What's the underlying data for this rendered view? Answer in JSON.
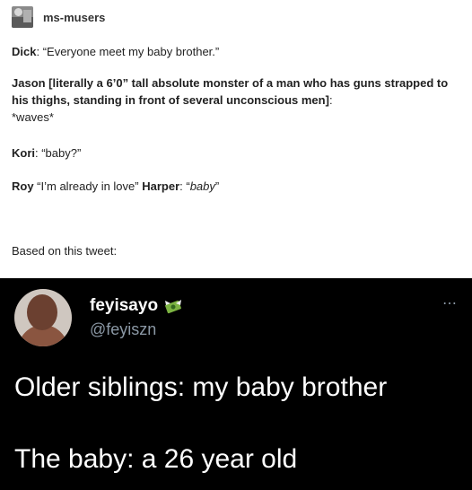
{
  "post": {
    "username": "ms-musers",
    "lines": {
      "dick_name": "Dick",
      "dick_text": ": “Everyone meet my baby brother.”",
      "jason_name": "Jason [literally a 6’0” tall absolute monster of a man who has guns strapped to his thighs, standing in front of several unconscious men]",
      "jason_colon": ":",
      "jason_text": "*waves*",
      "kori_name": "Kori",
      "kori_text": ": “baby?”",
      "roy_name": "Roy",
      "roy_text": " “I’m already in love” ",
      "harper_name": "Harper",
      "harper_colon": ": “",
      "harper_italic": "baby",
      "harper_end": "”",
      "based_on": "Based on this tweet:"
    }
  },
  "tweet": {
    "display_name": "feyisayo",
    "handle": "@feyiszn",
    "more_icon": "⋯",
    "line1": "Older siblings: my baby brother",
    "line2": "The baby: a 26 year old"
  }
}
